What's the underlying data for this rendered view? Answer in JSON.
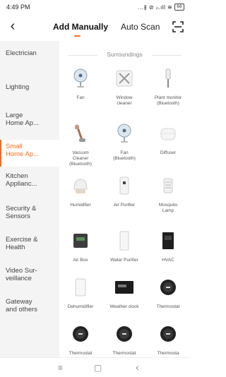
{
  "status_bar": {
    "time": "4:49 PM",
    "icons": "...∦ ⊘ ᵢₗ.ıll ≋",
    "battery": "66"
  },
  "nav": {
    "tabs": [
      {
        "label": "Add Manually",
        "active": true
      },
      {
        "label": "Auto Scan",
        "active": false
      }
    ],
    "accent_color": "#ff6a17",
    "back_icon": "back-chevron-icon",
    "scan_icon": "scan-icon"
  },
  "sidebar": {
    "items": [
      {
        "label": "Electrician"
      },
      {
        "label": "Lighting"
      },
      {
        "label": "Large\nHome Ap..."
      },
      {
        "label": "Small\nHome Ap...",
        "active": true
      },
      {
        "label": "Kitchen\nApplianc..."
      },
      {
        "label": "Security &\nSensors"
      },
      {
        "label": "Exercise &\nHealth"
      },
      {
        "label": "Video Sur-\nveillance"
      },
      {
        "label": "Gateway\nand others"
      }
    ]
  },
  "content": {
    "section_title": "Surroundings",
    "devices": [
      {
        "label": "Fan",
        "icon": "fan-icon"
      },
      {
        "label": "Window\ncleaner",
        "icon": "window-cleaner-icon"
      },
      {
        "label": "Plant monitor\n(Bluetooth)",
        "icon": "plant-monitor-icon"
      },
      {
        "label": "Vacuum\nCleaner\n(Bluetooth)",
        "icon": "vacuum-icon"
      },
      {
        "label": "Fan\n(Bluetooth)",
        "icon": "fan-icon"
      },
      {
        "label": "Diffuser",
        "icon": "diffuser-icon"
      },
      {
        "label": "Humidifier",
        "icon": "humidifier-icon"
      },
      {
        "label": "Air Purifier",
        "icon": "air-purifier-icon"
      },
      {
        "label": "Mosquito\nLamp",
        "icon": "mosquito-lamp-icon"
      },
      {
        "label": "Air Box",
        "icon": "air-box-icon"
      },
      {
        "label": "Water Purifier",
        "icon": "water-purifier-icon"
      },
      {
        "label": "HVAC",
        "icon": "hvac-icon"
      },
      {
        "label": "Dehumidifier",
        "icon": "dehumidifier-icon"
      },
      {
        "label": "Weather clock",
        "icon": "weather-clock-icon"
      },
      {
        "label": "Thermostat",
        "icon": "thermostat-icon"
      },
      {
        "label": "Thermostat",
        "icon": "thermostat-icon"
      },
      {
        "label": "Thermostat",
        "icon": "thermostat-icon"
      },
      {
        "label": "Thermosta",
        "icon": "thermostat-icon"
      }
    ]
  },
  "bottom_nav": {
    "menu": "≡",
    "home": "▢",
    "back": "‹"
  }
}
